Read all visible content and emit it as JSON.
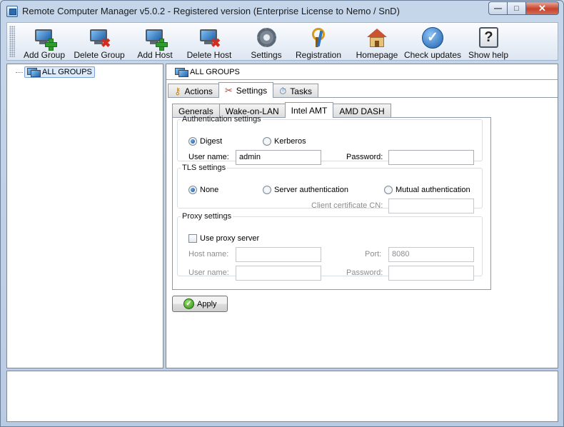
{
  "window": {
    "title": "Remote Computer Manager v5.0.2 - Registered version (Enterprise License to Nemo / SnD)",
    "controls": {
      "minimize": "—",
      "maximize": "□",
      "close": "✕"
    }
  },
  "toolbar": {
    "buttons": [
      {
        "label": "Add Group",
        "icon": "add-group-icon"
      },
      {
        "label": "Delete Group",
        "icon": "delete-group-icon"
      },
      {
        "label": "Add Host",
        "icon": "add-host-icon"
      },
      {
        "label": "Delete Host",
        "icon": "delete-host-icon"
      },
      {
        "label": "Settings",
        "icon": "gear-icon"
      },
      {
        "label": "Registration",
        "icon": "keys-icon"
      },
      {
        "label": "Homepage",
        "icon": "house-icon"
      },
      {
        "label": "Check updates",
        "icon": "check-icon"
      },
      {
        "label": "Show help",
        "icon": "help-icon"
      }
    ]
  },
  "tree": {
    "root": "ALL GROUPS"
  },
  "main": {
    "header": "ALL GROUPS",
    "tabs": [
      {
        "label": "Actions",
        "icon": "key-icon"
      },
      {
        "label": "Settings",
        "icon": "tools-icon",
        "active": true
      },
      {
        "label": "Tasks",
        "icon": "stopwatch-icon"
      }
    ],
    "subtabs": [
      {
        "label": "Generals"
      },
      {
        "label": "Wake-on-LAN"
      },
      {
        "label": "Intel AMT",
        "active": true
      },
      {
        "label": "AMD DASH"
      }
    ]
  },
  "auth": {
    "legend": "Authentication settings",
    "digest": "Digest",
    "kerberos": "Kerberos",
    "selected": "Digest",
    "username_label": "User name:",
    "username_value": "admin",
    "password_label": "Password:",
    "password_value": ""
  },
  "tls": {
    "legend": "TLS settings",
    "none": "None",
    "server": "Server authentication",
    "mutual": "Mutual authentication",
    "selected": "None",
    "cn_label": "Client certificate CN:",
    "cn_value": ""
  },
  "proxy": {
    "legend": "Proxy settings",
    "use_proxy": "Use proxy server",
    "use_proxy_checked": false,
    "host_label": "Host name:",
    "host_value": "",
    "port_label": "Port:",
    "port_value": "8080",
    "username_label": "User name:",
    "username_value": "",
    "password_label": "Password:",
    "password_value": ""
  },
  "apply_label": "Apply"
}
